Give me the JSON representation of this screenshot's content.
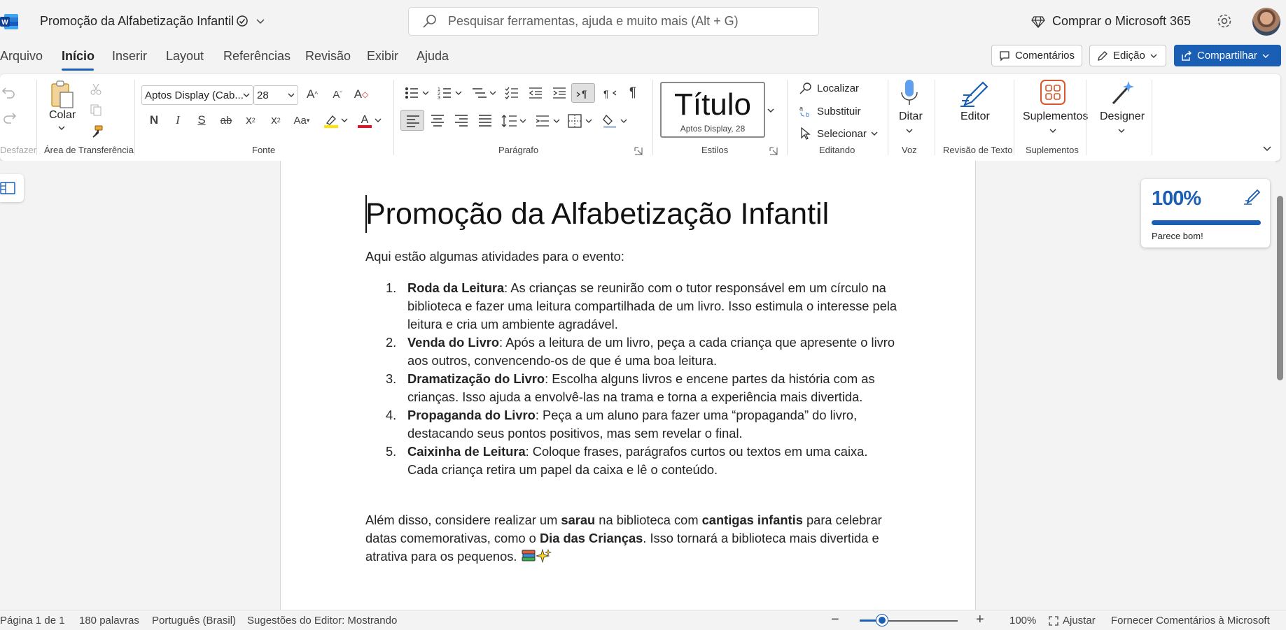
{
  "app": {
    "title": "Promoção da Alfabetização Infantil",
    "search_placeholder": "Pesquisar ferramentas, ajuda e muito mais (Alt + G)",
    "buy_label": "Comprar o Microsoft 365",
    "accent": "#1a5fb4"
  },
  "menu": {
    "tabs": [
      "Arquivo",
      "Início",
      "Inserir",
      "Layout",
      "Referências",
      "Revisão",
      "Exibir",
      "Ajuda"
    ],
    "active_tab": "Início",
    "comments_label": "Comentários",
    "editing_label": "Edição",
    "share_label": "Compartilhar"
  },
  "ribbon": {
    "undo_group": "Desfazer",
    "clipboard": {
      "label": "Área de Transferência",
      "paste": "Colar"
    },
    "font": {
      "label": "Fonte",
      "family": "Aptos Display (Cab...",
      "size": "28",
      "bold": "N",
      "italic": "I",
      "underline": "S",
      "strike": "ab",
      "sub": "x",
      "sup": "x",
      "case": "Aa"
    },
    "paragraph": {
      "label": "Parágrafo"
    },
    "styles": {
      "label": "Estilos",
      "current": "Título",
      "current_sub": "Aptos Display, 28"
    },
    "editing": {
      "label": "Editando",
      "find": "Localizar",
      "replace": "Substituir",
      "select": "Selecionar"
    },
    "voice": {
      "label": "Voz",
      "dictate": "Ditar"
    },
    "proofing": {
      "label": "Revisão de Texto",
      "editor": "Editor"
    },
    "addins": {
      "label": "Suplementos",
      "button": "Suplementos"
    },
    "designer": {
      "label": "Designer"
    }
  },
  "document": {
    "heading": "Promoção da Alfabetização Infantil",
    "intro": "Aqui estão algumas atividades para o evento:",
    "items": [
      {
        "num": "1.",
        "title": "Roda da Leitura",
        "text": ": As crianças se reunirão com o tutor responsável em um círculo na biblioteca e fazer uma leitura compartilhada de um livro. Isso estimula o interesse pela leitura e cria um ambiente agradável."
      },
      {
        "num": "2.",
        "title": "Venda do Livro",
        "text": ": Após a leitura de um livro, peça a cada criança que apresente o livro aos outros, convencendo-os de que é uma boa leitura."
      },
      {
        "num": "3.",
        "title": "Dramatização do Livro",
        "text": ": Escolha alguns livros e encene partes da história com as crianças. Isso ajuda a envolvê-las na trama e torna a experiência mais divertida."
      },
      {
        "num": "4.",
        "title": "Propaganda do Livro",
        "text": ": Peça a um aluno para fazer uma “propaganda” do livro, destacando seus pontos positivos, mas sem revelar o final."
      },
      {
        "num": "5.",
        "title": "Caixinha de Leitura",
        "text": ": Coloque frases, parágrafos curtos ou textos em uma caixa. Cada criança retira um papel da caixa e lê o conteúdo."
      }
    ],
    "outro": {
      "p1": "Além disso, considere realizar um ",
      "b1": "sarau",
      "p2": " na biblioteca com ",
      "b2": "cantigas infantis",
      "p3": " para celebrar datas comemorativas, como o ",
      "b3": "Dia das Crianças",
      "p4": ". Isso tornará a biblioteca mais divertida e atrativa para os pequenos. "
    }
  },
  "editor_card": {
    "score": "100%",
    "message": "Parece bom!"
  },
  "status": {
    "page": "Página 1 de 1",
    "words": "180 palavras",
    "language": "Português (Brasil)",
    "editor_suggestions": "Sugestões do Editor: Mostrando",
    "zoom": "100%",
    "zoom_level": 1.0,
    "fit": "Ajustar",
    "feedback": "Fornecer Comentários à Microsoft"
  }
}
